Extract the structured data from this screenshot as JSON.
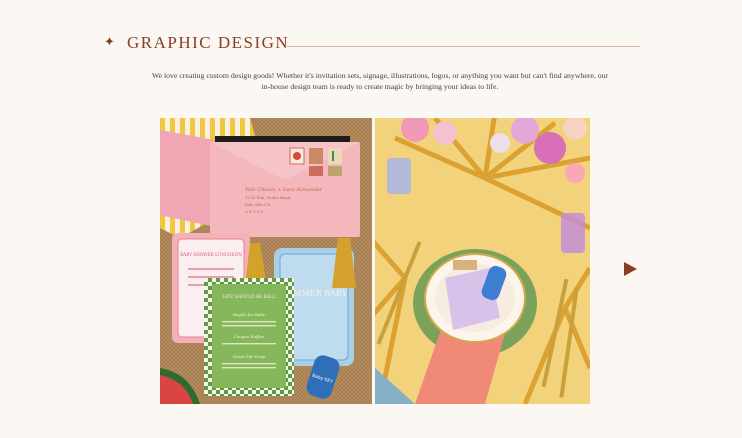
{
  "section": {
    "title": "GRAPHIC DESIGN",
    "description": "We love creating custom design goods! Whether it's invitation sets, signage, illustrations, logos, or anything you want but can't find anywhere, our in-house design team is ready to create magic by bringing your ideas to life."
  },
  "gallery": {
    "left_photo": {
      "envelope_address": [
        "Yuki Chavez + Lara Alexandar",
        "1230 Wm. Nobis Road",
        "Palo Alto CA",
        "9 4 3 0 6"
      ],
      "card_pink_title": "BABY SHOWER LUNCHEON",
      "card_blue_title": "SUMMER BABY",
      "card_green_title": "LIFE SHOULD BE BALL",
      "card_green_sections": [
        "Bagels for Babe",
        "Coupon Raffles",
        "Great Gift Swap"
      ],
      "keychain_text": "Baby KEY"
    },
    "next_icon": "triangle-right-icon"
  },
  "colors": {
    "accent": "#8a3f22",
    "background": "#fbf7f2",
    "rule": "#d6b3a6"
  }
}
